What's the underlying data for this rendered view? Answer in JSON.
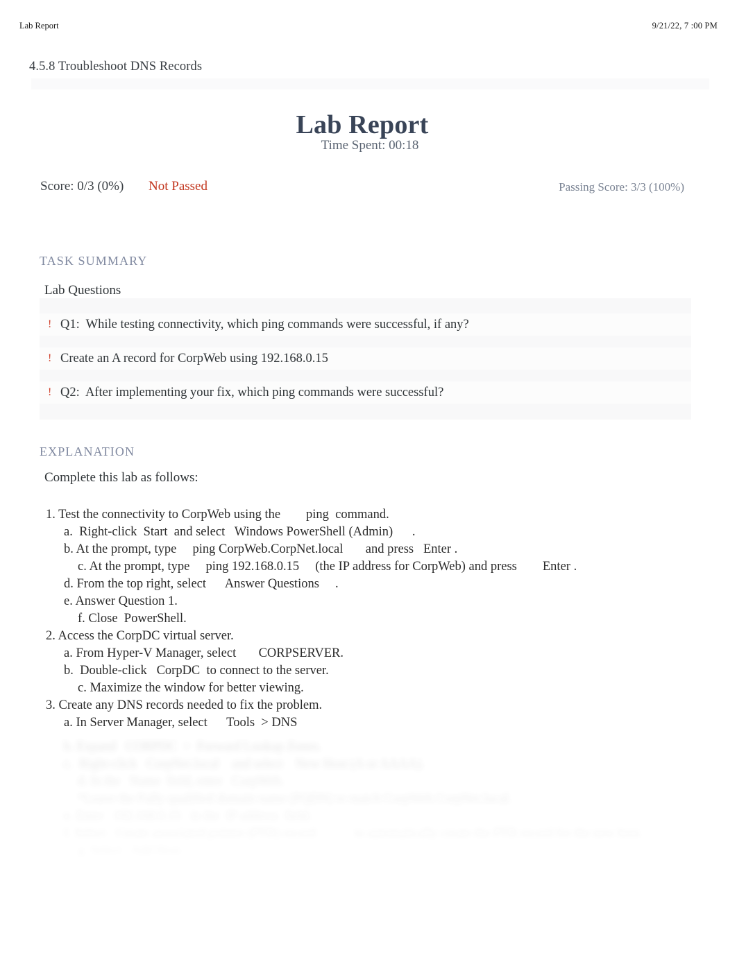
{
  "print_header": {
    "title": "Lab Report",
    "timestamp": "9/21/22, 7 :00 PM"
  },
  "report": {
    "lab_code": "4.5.8 Troubleshoot DNS Records",
    "title": "Lab Report",
    "time_spent": "Time Spent: 00:18",
    "score": "Score: 0/3 (0%)",
    "pass_status": "Not Passed",
    "passing_score": "Passing Score: 3/3 (100%)",
    "status_color": "#c2351d"
  },
  "task_summary": {
    "heading": "TASK SUMMARY",
    "subheading": "Lab Questions",
    "questions": [
      {
        "mark": "!",
        "text": "Q1:  While testing connectivity, which ping commands were successful, if any?"
      },
      {
        "mark": "!",
        "text": "Create an A record for CorpWeb using 192.168.0.15"
      },
      {
        "mark": "!",
        "text": "Q2:  After implementing your fix, which ping commands were successful?"
      }
    ]
  },
  "explanation": {
    "heading": "EXPLANATION",
    "intro": "Complete this lab as follows:",
    "steps": [
      {
        "level": 1,
        "text": "1. Test the connectivity to CorpWeb using the        ping  command."
      },
      {
        "level": 2,
        "text": "a.  Right-click  Start  and select   Windows PowerShell (Admin)      ."
      },
      {
        "level": 2,
        "text": "b. At the prompt, type     ping CorpWeb.CorpNet.local       and press   Enter ."
      },
      {
        "level": 3,
        "text": "c. At the prompt, type     ping 192.168.0.15     (the IP address for CorpWeb) and press        Enter ."
      },
      {
        "level": 2,
        "text": "d. From the top right, select      Answer Questions     ."
      },
      {
        "level": 2,
        "text": "e. Answer Question 1."
      },
      {
        "level": 3,
        "text": "f. Close  PowerShell."
      },
      {
        "level": 1,
        "text": "2. Access the CorpDC virtual server."
      },
      {
        "level": 2,
        "text": "a. From Hyper-V Manager, select       CORPSERVER."
      },
      {
        "level": 2,
        "text": "b.  Double-click   CorpDC  to connect to the server."
      },
      {
        "level": 3,
        "text": "c. Maximize the window for better viewing."
      },
      {
        "level": 1,
        "text": "3. Create any DNS records needed to fix the problem."
      },
      {
        "level": 2,
        "text": "a. In Server Manager, select      Tools  > DNS"
      }
    ],
    "faded_steps": [
      {
        "level": 2,
        "text": "b. Expand   CORPDC  >  Forward Lookup Zones."
      },
      {
        "level": 2,
        "text": "c.  Right-click   CorpNet.local    and select    New Host (A or AAAA)."
      },
      {
        "level": 3,
        "text": "d. In the   Name  field, enter   CorpWeb."
      },
      {
        "level": 3,
        "text": "*Leave the Fully qualified domain name (FQDN) to match CorpWeb.CorpNet.local."
      },
      {
        "level": 2,
        "text": "e. Enter   192.168.0.15   in the  IP address  field."
      },
      {
        "level": 2,
        "text": "f. Select   Create associated pointer (PTR) record            to automatically create the PTR record for the new host."
      },
      {
        "level": 3,
        "text": "g. Select   Add Host."
      }
    ]
  }
}
